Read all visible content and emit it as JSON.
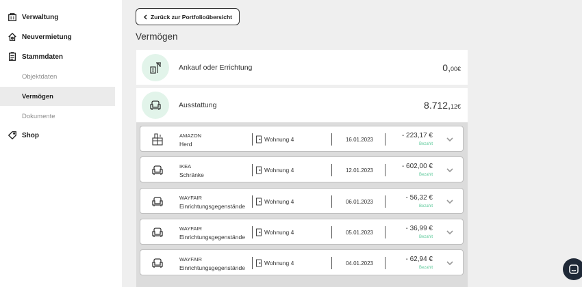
{
  "sidebar": {
    "items": [
      {
        "label": "Verwaltung",
        "icon": "building-icon"
      },
      {
        "label": "Neuvermietung",
        "icon": "house-key-icon"
      },
      {
        "label": "Stammdaten",
        "icon": "document-list-icon"
      }
    ],
    "sub_items": [
      {
        "label": "Objektdaten",
        "active": false
      },
      {
        "label": "Vermögen",
        "active": true
      },
      {
        "label": "Dokumente",
        "active": false
      }
    ],
    "shop": {
      "label": "Shop",
      "icon": "tag-icon"
    }
  },
  "back_button": {
    "label": "Zurück zur Portfolioübersicht",
    "icon": "chevron-left-icon"
  },
  "page_title": "Vermögen",
  "categories": [
    {
      "label": "Ankauf oder Errichtung",
      "amount_main": "0,",
      "amount_cents": "00€",
      "icon": "construction-icon"
    },
    {
      "label": "Ausstattung",
      "amount_main": "8.712,",
      "amount_cents": "12€",
      "icon": "armchair-icon"
    }
  ],
  "expenses": [
    {
      "vendor": "AMAZON",
      "item": "Herd",
      "unit": "Wohnung 4",
      "date": "16.01.2023",
      "amount": "- 223,17 €",
      "status": "Bezahlt",
      "icon": "kitchen-icon"
    },
    {
      "vendor": "IKEA",
      "item": "Schränke",
      "unit": "Wohnung 4",
      "date": "12.01.2023",
      "amount": "- 602,00 €",
      "status": "Bezahlt",
      "icon": "armchair-icon"
    },
    {
      "vendor": "WAYFAIR",
      "item": "Einrichtungsgegenstände",
      "unit": "Wohnung 4",
      "date": "06.01.2023",
      "amount": "- 56,32 €",
      "status": "Bezahlt",
      "icon": "armchair-icon"
    },
    {
      "vendor": "WAYFAIR",
      "item": "Einrichtungsgegenstände",
      "unit": "Wohnung 4",
      "date": "05.01.2023",
      "amount": "- 36,99 €",
      "status": "Bezahlt",
      "icon": "armchair-icon"
    },
    {
      "vendor": "WAYFAIR",
      "item": "Einrichtungsgegenstände",
      "unit": "Wohnung 4",
      "date": "04.01.2023",
      "amount": "- 62,94 €",
      "status": "Bezahlt",
      "icon": "armchair-icon"
    }
  ],
  "colors": {
    "accent_green": "#5cc99a",
    "icon_bg": "#e2f4ea",
    "chat_button": "#1f2937"
  }
}
